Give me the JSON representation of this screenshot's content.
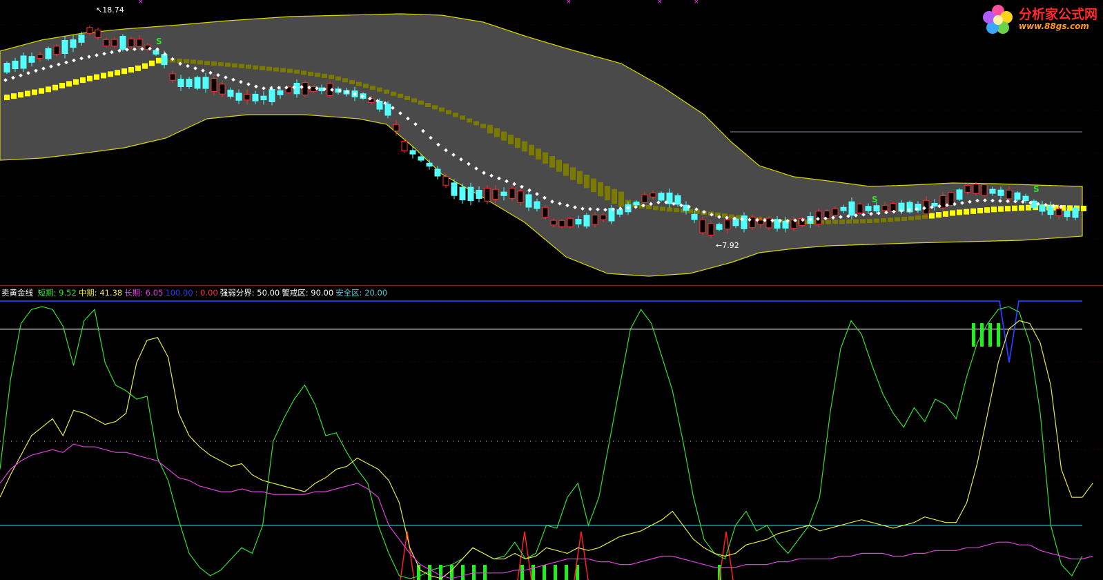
{
  "branding": {
    "name": "分析家公式网",
    "url": "www.88gs.com"
  },
  "indicator_header": {
    "name": "卖黄金线",
    "items": [
      {
        "label": "短期:",
        "value": "9.52",
        "color": "#33e033"
      },
      {
        "label": "中期:",
        "value": "41.38",
        "color": "#e8e84a"
      },
      {
        "label": "长期:",
        "value": "6.05",
        "color": "#e040e0"
      },
      {
        "label": "",
        "value": "100.00",
        "color": "#2040ff"
      },
      {
        "label": ":",
        "value": "0.00",
        "color": "#ff3030"
      },
      {
        "label": "强弱分界:",
        "value": "50.00",
        "color": "#ffffff"
      },
      {
        "label": "警戒区:",
        "value": "90.00",
        "color": "#ffffff"
      },
      {
        "label": "安全区:",
        "value": "20.00",
        "color": "#4cc8d8"
      }
    ]
  },
  "chart_data": [
    {
      "type": "candlestick",
      "annotations": {
        "high_label": "18.74",
        "low_label": "7.92",
        "signal_marks": [
          "S",
          "S",
          "S"
        ]
      },
      "colors": {
        "up": "#ff3030",
        "down": "#54ffff",
        "band": "#4a4a4a",
        "band_edge": "#d8d800",
        "trend_line": "#ffff00",
        "trend_line_dim": "#7a7a00",
        "dots": "#ffffff"
      },
      "note": "price panel: candles inside a volatility band with a dotted trailing stop and a stepped yellow trend line"
    },
    {
      "type": "line",
      "ylim": [
        0,
        100
      ],
      "levels": [
        {
          "name": "强弱分界",
          "value": 50
        },
        {
          "name": "警戒区",
          "value": 90
        },
        {
          "name": "安全区",
          "value": 20
        }
      ],
      "series": [
        {
          "name": "短期",
          "color": "#33e033",
          "values": [
            40,
            72,
            92,
            97,
            98,
            97,
            91,
            77,
            93,
            97,
            78,
            70,
            68,
            65,
            66,
            44,
            36,
            22,
            10,
            5,
            2,
            4,
            8,
            12,
            10,
            20,
            50,
            58,
            65,
            70,
            63,
            52,
            53,
            46,
            40,
            35,
            20,
            10,
            2,
            1,
            2,
            4,
            5,
            6,
            8,
            12,
            10,
            8,
            9,
            14,
            8,
            10,
            20,
            19,
            30,
            35,
            20,
            30,
            50,
            70,
            90,
            97,
            92,
            80,
            68,
            50,
            30,
            15,
            10,
            8,
            20,
            25,
            18,
            20,
            14,
            10,
            15,
            20,
            30,
            60,
            83,
            93,
            88,
            77,
            67,
            60,
            55,
            62,
            57,
            65,
            63,
            58,
            73,
            85,
            92,
            97,
            98,
            96,
            85,
            60,
            20,
            6,
            2,
            9
          ]
        },
        {
          "name": "中期",
          "color": "#e8e84a",
          "values": [
            30,
            38,
            45,
            52,
            55,
            58,
            52,
            61,
            60,
            58,
            56,
            57,
            60,
            78,
            86,
            87,
            80,
            60,
            52,
            48,
            45,
            43,
            41,
            42,
            38,
            36,
            35,
            34,
            33,
            32,
            35,
            37,
            40,
            41,
            44,
            42,
            40,
            36,
            28,
            12,
            4,
            2,
            1,
            4,
            8,
            12,
            10,
            8,
            8,
            10,
            8,
            9,
            12,
            11,
            10,
            12,
            11,
            12,
            14,
            16,
            17,
            18,
            20,
            22,
            25,
            20,
            15,
            12,
            10,
            9,
            10,
            13,
            14,
            15,
            17,
            18,
            19,
            20,
            18,
            19,
            20,
            21,
            22,
            21,
            20,
            19,
            20,
            21,
            23,
            22,
            21,
            21,
            28,
            42,
            60,
            78,
            90,
            93,
            92,
            85,
            70,
            40,
            30,
            30,
            35
          ]
        },
        {
          "name": "长期",
          "color": "#e040e0",
          "values": [
            35,
            40,
            43,
            45,
            46,
            47,
            46,
            49,
            48,
            48,
            47,
            46,
            46,
            45,
            44,
            43,
            40,
            37,
            36,
            34,
            33,
            32,
            32,
            33,
            32,
            32,
            31,
            31,
            31,
            31,
            32,
            32,
            33,
            34,
            35,
            33,
            30,
            20,
            15,
            10,
            6,
            4,
            2,
            1,
            2,
            3,
            3,
            3,
            3,
            4,
            4,
            5,
            6,
            7,
            8,
            8,
            8,
            7,
            7,
            6,
            6,
            7,
            8,
            9,
            9,
            8,
            7,
            6,
            5,
            5,
            5,
            6,
            6,
            6,
            7,
            7,
            8,
            8,
            8,
            8,
            9,
            9,
            10,
            10,
            10,
            9,
            9,
            10,
            10,
            11,
            11,
            11,
            12,
            12,
            13,
            14,
            14,
            13,
            13,
            11,
            10,
            9,
            8,
            8,
            9
          ]
        }
      ]
    }
  ]
}
